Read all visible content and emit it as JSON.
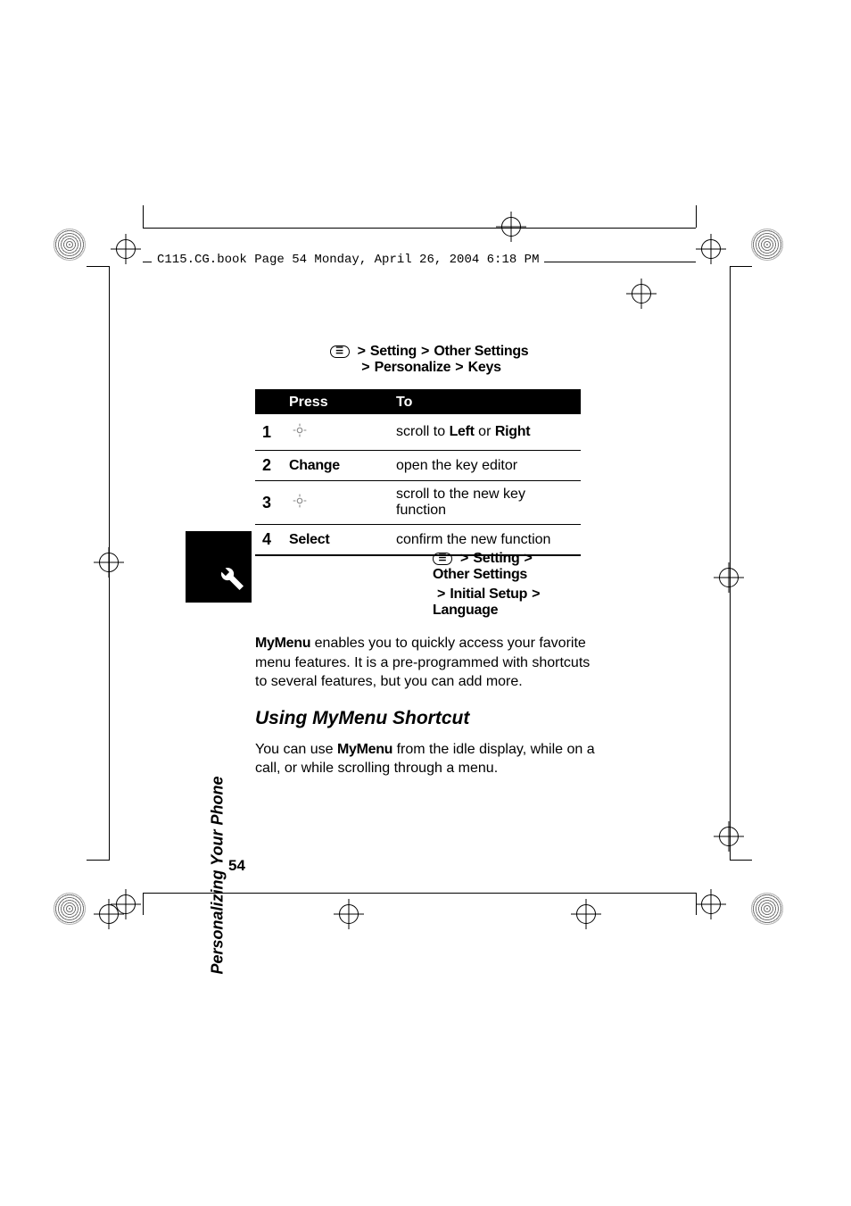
{
  "header": {
    "text": "C115.CG.book  Page 54  Monday, April 26, 2004  6:18 PM"
  },
  "sideTab": "Personalizing Your Phone",
  "find1": {
    "seg1": "Setting",
    "seg2": "Other Settings",
    "seg3": "Personalize",
    "seg4": "Keys"
  },
  "table": {
    "head": {
      "col1": "",
      "col2": "Press",
      "col3": "To"
    },
    "rows": [
      {
        "n": "1",
        "press": "",
        "pressIcon": true,
        "to_pre": "scroll to ",
        "to_b1": "Left",
        "to_mid": " or ",
        "to_b2": "Right",
        "to_post": ""
      },
      {
        "n": "2",
        "press": "Change",
        "pressIcon": false,
        "to_pre": "open the key editor",
        "to_b1": "",
        "to_mid": "",
        "to_b2": "",
        "to_post": ""
      },
      {
        "n": "3",
        "press": "",
        "pressIcon": true,
        "to_pre": "scroll to the new key function",
        "to_b1": "",
        "to_mid": "",
        "to_b2": "",
        "to_post": ""
      },
      {
        "n": "4",
        "press": "Select",
        "pressIcon": false,
        "to_pre": "confirm the new function",
        "to_b1": "",
        "to_mid": "",
        "to_b2": "",
        "to_post": ""
      }
    ]
  },
  "find2": {
    "seg1": "Setting",
    "seg2": "Other Settings",
    "seg3": "Initial Setup",
    "seg4": "Language"
  },
  "para1_b": "MyMenu",
  "para1": " enables you to quickly access your favorite menu features. It is a pre-programmed with shortcuts to several features, but you can add more.",
  "heading2": "Using MyMenu Shortcut",
  "para2_pre": "You can use ",
  "para2_b": "MyMenu",
  "para2_post": " from the idle display, while on a call, or while scrolling through a menu.",
  "pageNumber": "54"
}
